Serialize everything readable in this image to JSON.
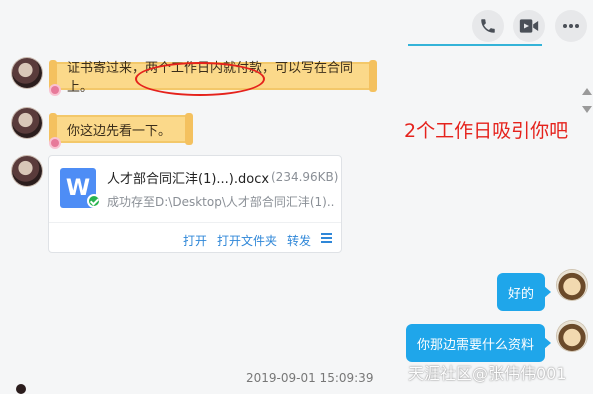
{
  "toolbar": {
    "phone_icon": "phone-icon",
    "video_icon": "video-camera-icon",
    "more_icon": "more-dots-icon",
    "accent": "#34b3d8"
  },
  "messages": {
    "msg1": "证书寄过来，两个工作日内就付款，可以写在合同上。",
    "msg2": "你这边先看一下。",
    "annotation": "2个工作日吸引你吧"
  },
  "file": {
    "name": "人才部合同汇沣(1)...).docx",
    "size": "(234.96KB)",
    "status": "成功存至D:\\Desktop\\人才部合同汇沣(1)...",
    "actions": {
      "open": "打开",
      "open_folder": "打开文件夹",
      "forward": "转发"
    },
    "icon": "word-doc-icon"
  },
  "replies": {
    "reply1": "好的",
    "reply2": "你那边需要什么资料"
  },
  "timestamp": "2019-09-01 15:09:39",
  "watermark": "天涯社区@张伟伟001",
  "colors": {
    "bubble_scroll": "#fbd98a",
    "bubble_blue": "#1fa6ea",
    "highlight": "#e5221c",
    "link": "#2f87d8"
  }
}
